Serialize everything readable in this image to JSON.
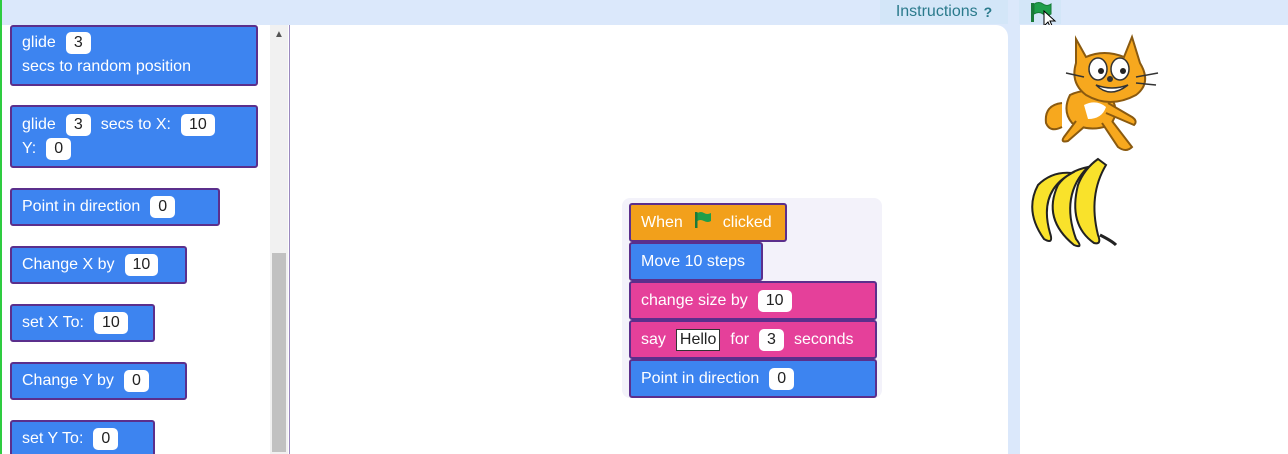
{
  "header": {
    "instructions_label": "Instructions",
    "help_glyph": "?",
    "run_icon": "green-flag-icon"
  },
  "palette": {
    "blocks": [
      {
        "id": "glide-random",
        "text1": "glide",
        "value": "3",
        "text2": "secs to random position"
      },
      {
        "id": "glide-xy",
        "text1": "glide",
        "value1": "3",
        "text2": "secs to X:",
        "value2": "10",
        "text3": "Y:",
        "value3": "0"
      },
      {
        "id": "point-direction",
        "text": "Point in direction",
        "value": "0"
      },
      {
        "id": "change-x",
        "text": "Change X by",
        "value": "10"
      },
      {
        "id": "set-x",
        "text": "set X To:",
        "value": "10"
      },
      {
        "id": "change-y",
        "text": "Change Y by",
        "value": "0"
      },
      {
        "id": "set-y",
        "text": "set Y To:",
        "value": "0"
      }
    ]
  },
  "script": {
    "when": {
      "text1": "When",
      "text2": "clicked",
      "icon": "green-flag-icon"
    },
    "move": {
      "text": "Move 10 steps"
    },
    "size": {
      "text": "change size by",
      "value": "10"
    },
    "say": {
      "text1": "say",
      "message": "Hello",
      "text2": "for",
      "value": "3",
      "text3": "seconds"
    },
    "point": {
      "text": "Point in direction",
      "value": "0"
    }
  },
  "stage": {
    "sprites": [
      "cat-sprite",
      "banana-sprite"
    ]
  },
  "colors": {
    "motion": "#3d84f0",
    "events": "#f2a01b",
    "looks": "#e5409a",
    "border": "#5b2f8c",
    "flag": "#1e9e4a"
  }
}
